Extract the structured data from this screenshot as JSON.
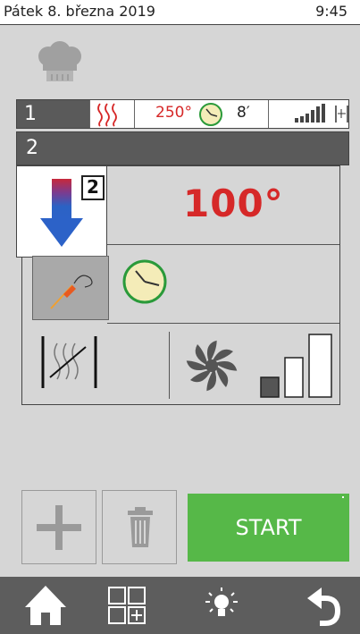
{
  "status_bar": {
    "date": "Pátek 8. března 2019",
    "time": "9:45"
  },
  "step1": {
    "number": "1",
    "temperature": "250°",
    "time": "8′"
  },
  "step2": {
    "number": "2",
    "target_temperature": "100°",
    "mode_badge": "2"
  },
  "actions": {
    "start_label": "START"
  },
  "icons": {
    "chef": "chef-hat-icon",
    "heat": "heating-icon",
    "timer": "clock-icon",
    "fan_level": "fan-level-icon",
    "filter": "filter-icon",
    "down_arrow": "cooling-arrow-icon",
    "probe": "core-probe-icon",
    "fan": "fan-icon",
    "humidity": "humidity-icon",
    "plus": "plus-icon",
    "trash": "trash-icon",
    "home": "home-icon",
    "programs": "programs-grid-icon",
    "light": "light-icon",
    "back": "back-icon"
  },
  "colors": {
    "accent_red": "#d62828",
    "start_green": "#56b848",
    "nav_bg": "#5d5d5d"
  },
  "fan_speed_level": 1
}
